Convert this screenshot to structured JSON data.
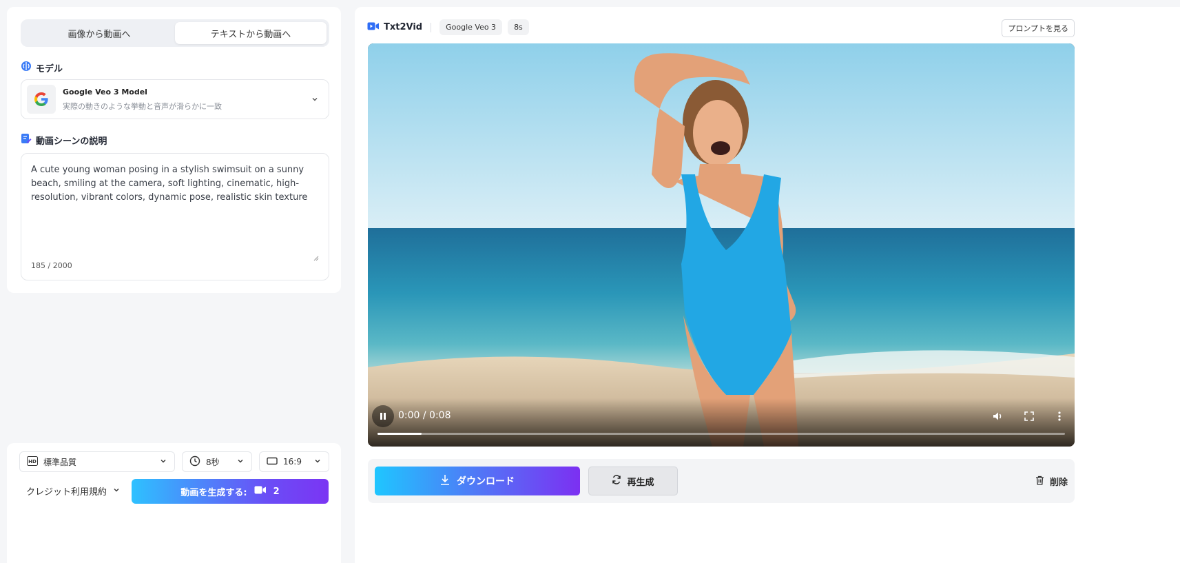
{
  "mode_tabs": [
    {
      "label": "画像から動画へ",
      "active": false
    },
    {
      "label": "テキストから動画へ",
      "active": true
    }
  ],
  "model_section": {
    "title": "モデル",
    "selected_name": "Google Veo 3 Model",
    "selected_desc": "実際の動きのような挙動と音声が滑らかに一致",
    "icon": "google-logo-icon"
  },
  "scene_section": {
    "title": "動画シーンの説明",
    "prompt": "A cute young woman posing in a stylish swimsuit on a sunny beach, smiling at the camera, soft lighting, cinematic, high-resolution, vibrant colors, dynamic pose, realistic skin texture",
    "counter": "185 / 2000"
  },
  "settings": {
    "quality": "標準品質",
    "duration": "8秒",
    "aspect": "16:9",
    "credit_terms": "クレジット利用規約",
    "generate_label": "動画を生成する:",
    "generate_cost": "2"
  },
  "preview": {
    "brand": "Txt2Vid",
    "model_chip": "Google Veo 3",
    "duration_chip": "8s",
    "view_prompt": "プロンプトを見る",
    "time": "0:00 / 0:08",
    "progress": 0.064
  },
  "actions": {
    "download": "ダウンロード",
    "regenerate": "再生成",
    "delete": "削除"
  },
  "colors": {
    "accent_start": "#2ec1ff",
    "accent_end": "#7b35f3"
  }
}
